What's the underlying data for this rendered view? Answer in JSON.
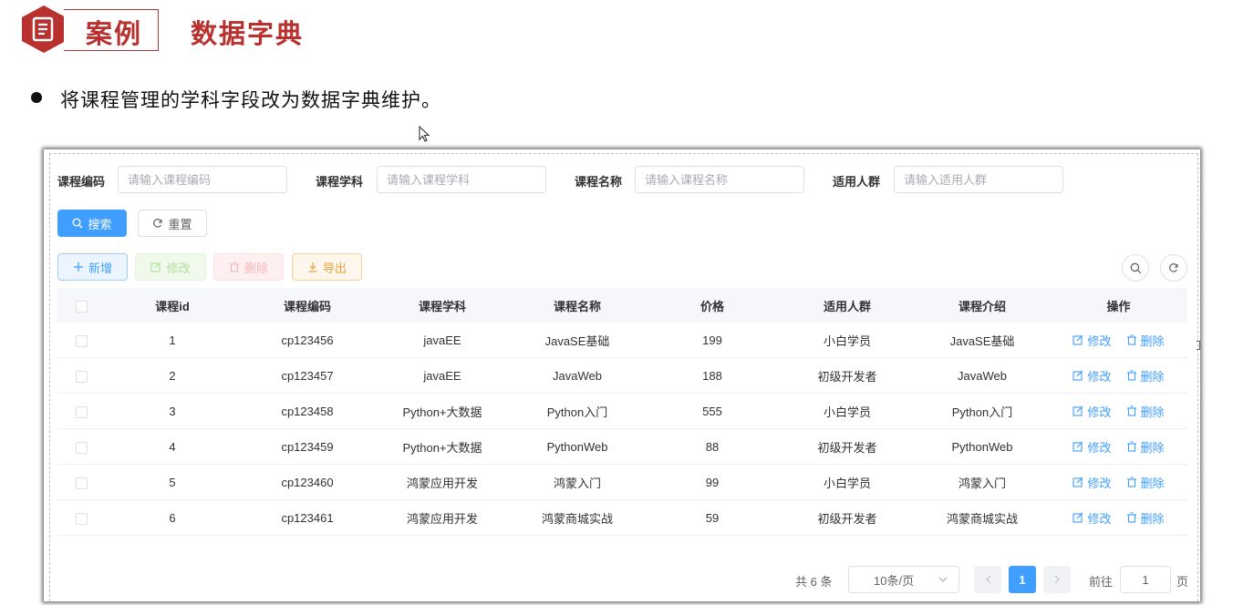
{
  "slide": {
    "tag": "案例",
    "title": "数据字典",
    "bullet": "将课程管理的学科字段改为数据字典维护。"
  },
  "colors": {
    "brand_red": "#b8312f",
    "primary": "#409eff",
    "success": "#67c23a",
    "danger": "#f56c6c",
    "warning": "#e6a23c"
  },
  "search": {
    "fields": [
      {
        "label": "课程编码",
        "placeholder": "请输入课程编码",
        "value": ""
      },
      {
        "label": "课程学科",
        "placeholder": "请输入课程学科",
        "value": ""
      },
      {
        "label": "课程名称",
        "placeholder": "请输入课程名称",
        "value": ""
      },
      {
        "label": "适用人群",
        "placeholder": "请输入适用人群",
        "value": ""
      }
    ],
    "search_label": "搜索",
    "reset_label": "重置"
  },
  "toolbar": {
    "add_label": "新增",
    "edit_label": "修改",
    "delete_label": "删除",
    "export_label": "导出"
  },
  "table": {
    "columns": [
      "课程id",
      "课程编码",
      "课程学科",
      "课程名称",
      "价格",
      "适用人群",
      "课程介绍",
      "操作"
    ],
    "rows": [
      {
        "id": "1",
        "code": "cp123456",
        "subject": "javaEE",
        "name": "JavaSE基础",
        "price": "199",
        "audience": "小白学员",
        "intro": "JavaSE基础"
      },
      {
        "id": "2",
        "code": "cp123457",
        "subject": "javaEE",
        "name": "JavaWeb",
        "price": "188",
        "audience": "初级开发者",
        "intro": "JavaWeb"
      },
      {
        "id": "3",
        "code": "cp123458",
        "subject": "Python+大数据",
        "name": "Python入门",
        "price": "555",
        "audience": "小白学员",
        "intro": "Python入门"
      },
      {
        "id": "4",
        "code": "cp123459",
        "subject": "Python+大数据",
        "name": "PythonWeb",
        "price": "88",
        "audience": "初级开发者",
        "intro": "PythonWeb"
      },
      {
        "id": "5",
        "code": "cp123460",
        "subject": "鸿蒙应用开发",
        "name": "鸿蒙入门",
        "price": "99",
        "audience": "小白学员",
        "intro": "鸿蒙入门"
      },
      {
        "id": "6",
        "code": "cp123461",
        "subject": "鸿蒙应用开发",
        "name": "鸿蒙商城实战",
        "price": "59",
        "audience": "初级开发者",
        "intro": "鸿蒙商城实战"
      }
    ],
    "row_edit_label": "修改",
    "row_delete_label": "删除"
  },
  "pagination": {
    "total_text": "共 6 条",
    "page_size": "10条/页",
    "current_page": "1",
    "goto_prefix": "前往",
    "goto_value": "1",
    "goto_suffix": "页"
  }
}
